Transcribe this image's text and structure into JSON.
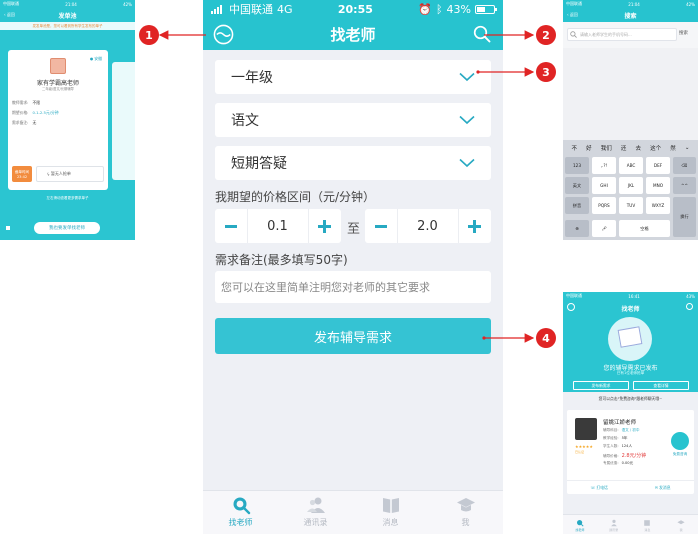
{
  "main": {
    "status": {
      "carrier": "中国联通",
      "network": "4G",
      "time": "20:55",
      "battery": "43%"
    },
    "title": "找老师",
    "grade": "一年级",
    "subject": "语文",
    "type": "短期答疑",
    "price_label": "我期望的价格区间（元/分钟）",
    "price_min": "0.1",
    "price_sep": "至",
    "price_max": "2.0",
    "remark_label": "需求备注(最多填写50字)",
    "remark_placeholder": "您可以在这里简单注明您对老师的其它要求",
    "submit": "发布辅导需求",
    "tabs": [
      "找老师",
      "通讯录",
      "消息",
      "我"
    ]
  },
  "callouts": [
    "1",
    "2",
    "3",
    "4"
  ],
  "left": {
    "status": {
      "carrier": "中国联通",
      "network": "4G",
      "time": "21:04",
      "battery": "42%"
    },
    "back": "返回",
    "title": "发单池",
    "notice": "发发单池是，您可以看到所有学生发布的单子",
    "auth": "安徽",
    "teacher": "家有学霸高老师",
    "teacher_sub": "二年级/语文/长期辅导",
    "rows": [
      {
        "label": "教师需求:",
        "value": "不限"
      },
      {
        "label": "期望价格:",
        "value": "0.1-2.5元/分钟"
      },
      {
        "label": "需求备注:",
        "value": "无"
      }
    ],
    "orange_l1": "截单时间",
    "orange_l2": "23:42",
    "claim": "暂无人抢单",
    "hint": "左右滑动查看更多需求单子",
    "bottom_btn": "我也要发单找老师"
  },
  "search": {
    "status": {
      "carrier": "中国联通",
      "network": "4G",
      "time": "21:04",
      "battery": "42%"
    },
    "back": "返回",
    "title": "搜索",
    "placeholder": "请输入老师学生的手机号码...",
    "btn": "搜索",
    "candidates": [
      "不",
      "好",
      "我们",
      "还",
      "去",
      "这个",
      "然"
    ],
    "keys": {
      "r1": [
        "123",
        ",.?!",
        "ABC",
        "DEF"
      ],
      "r2": [
        "英文",
        "GHI",
        "JKL",
        "MNO"
      ],
      "r3": [
        "拼音",
        "PQRS",
        "TUV",
        "WXYZ"
      ],
      "enter": "换行",
      "space": "空格"
    }
  },
  "pub": {
    "status": {
      "carrier": "中国联通",
      "network": "4G",
      "time": "16:41",
      "battery": "43%"
    },
    "title": "找老师",
    "pub_title": "您的辅导需求已发布",
    "pub_sub": "已有1位老师抢单",
    "btn1": "发布新需求",
    "btn2": "查看详情",
    "tip": "您可以点击\"免费咨询\"跟老师聊天哦~",
    "teacher": "留姚江娇老师",
    "rows": [
      {
        "label": "辅导科目:",
        "value": "语文 / 初中"
      },
      {
        "label": "教学经验:",
        "value": "5年"
      },
      {
        "label": "学生人数:",
        "value": "124人"
      },
      {
        "label": "辅导价格:",
        "value": "2.8元/分钟"
      },
      {
        "label": "专属优惠:",
        "value": "0.00元"
      }
    ],
    "stars": "★★★★★",
    "rb": "已认证",
    "chat": "免费咨询",
    "f1": "打电话",
    "f2": "发消息",
    "tabs": [
      "找老师",
      "通讯录",
      "消息",
      "我"
    ]
  }
}
